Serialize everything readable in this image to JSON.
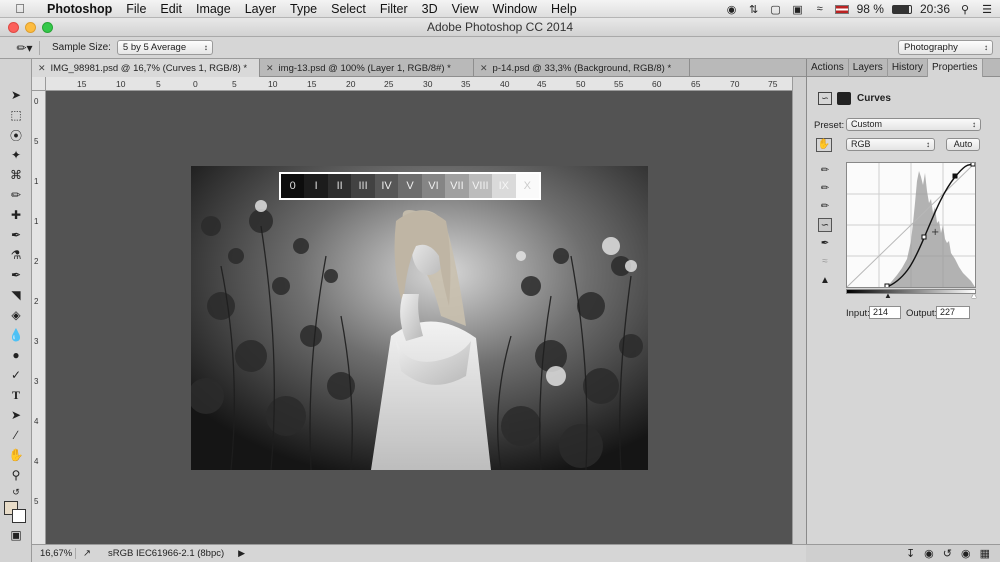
{
  "menubar": {
    "app_name": "Photoshop",
    "items": [
      "File",
      "Edit",
      "Image",
      "Layer",
      "Type",
      "Select",
      "Filter",
      "3D",
      "View",
      "Window",
      "Help"
    ],
    "battery": "98 %",
    "time": "20:36"
  },
  "window": {
    "title": "Adobe Photoshop CC 2014"
  },
  "options": {
    "sample_size_label": "Sample Size:",
    "sample_size_value": "5 by 5 Average",
    "workspace": "Photography"
  },
  "tabs": [
    {
      "label": "IMG_98981.psd @ 16,7% (Curves 1, RGB/8) *"
    },
    {
      "label": "img-13.psd @ 100% (Layer 1, RGB/8#) *"
    },
    {
      "label": "p-14.psd @ 33,3% (Background, RGB/8) *"
    }
  ],
  "ruler": {
    "h_ticks": [
      "15",
      "10",
      "5",
      "0",
      "5",
      "10",
      "15",
      "20",
      "25",
      "30",
      "35",
      "40",
      "45",
      "50",
      "55",
      "60",
      "65",
      "70",
      "75"
    ],
    "v_ticks": [
      "0",
      "5",
      "1",
      "1",
      "2",
      "2",
      "3",
      "3",
      "4",
      "4",
      "5"
    ]
  },
  "canvas": {
    "gray_steps": [
      "0",
      "I",
      "II",
      "III",
      "IV",
      "V",
      "VI",
      "VII",
      "VIII",
      "IX",
      "X"
    ]
  },
  "status": {
    "zoom": "16,67%",
    "profile": "sRGB IEC61966-2.1 (8bpc)"
  },
  "panel": {
    "tabs": [
      "Actions",
      "Layers",
      "History",
      "Properties"
    ],
    "title": "Curves",
    "preset_label": "Preset:",
    "preset_value": "Custom",
    "channel": "RGB",
    "auto_label": "Auto",
    "input_label": "Input:",
    "input_value": "214",
    "output_label": "Output:",
    "output_value": "227"
  },
  "colors": {
    "accent": "#4a4a4a",
    "canvas_bg": "#535353"
  }
}
